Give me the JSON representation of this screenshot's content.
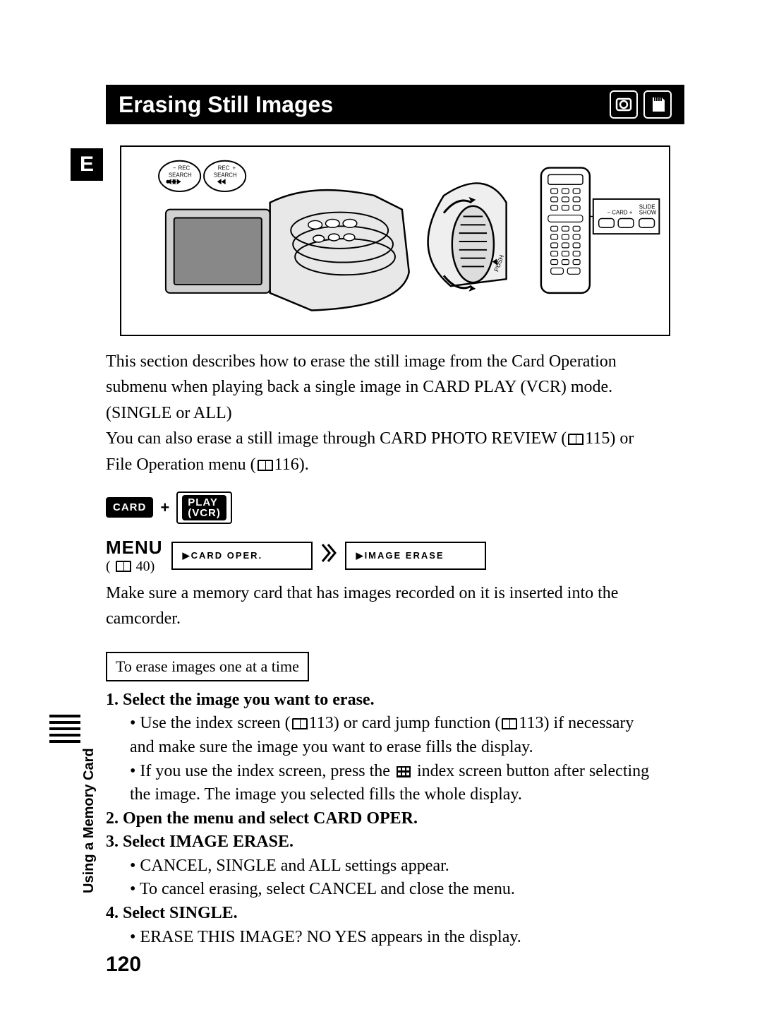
{
  "title": "Erasing Still Images",
  "lang_badge": "E",
  "intro": {
    "l1": "This section describes how to erase the still image from the Card Operation",
    "l2": "submenu when playing back a single image in CARD PLAY (VCR) mode.",
    "l3": "(SINGLE or ALL)",
    "l4a": "You can also erase a still image through CARD PHOTO REVIEW (",
    "l4b": "115) or",
    "l5a": "File Operation menu (",
    "l5b": "116)."
  },
  "mode": {
    "card": "CARD",
    "play": "PLAY",
    "vcr": "(VCR)"
  },
  "menu": {
    "label": "MENU",
    "ref": "40)",
    "box1": "CARD OPER.",
    "box2": "IMAGE ERASE"
  },
  "note": {
    "l1": "Make sure a memory card that has images recorded on it is inserted into the",
    "l2": "camcorder."
  },
  "inset": "To erase images one at a time",
  "steps": {
    "s1": "1. Select the image you want to erase.",
    "s1b1a": "Use the index screen (",
    "s1b1b": "113) or card jump function (",
    "s1b1c": "113) if necessary",
    "s1b1d": "and make sure the image you want to erase fills the display.",
    "s1b2a": "If you use the index screen, press the ",
    "s1b2b": " index screen button after selecting",
    "s1b2c": "the image. The image you selected fills the whole display.",
    "s2": "2. Open the menu and select CARD OPER.",
    "s3": "3. Select IMAGE ERASE.",
    "s3b1": "CANCEL, SINGLE and ALL settings appear.",
    "s3b2": "To cancel erasing, select CANCEL and close the menu.",
    "s4": "4. Select SINGLE.",
    "s4b1": "ERASE THIS IMAGE? NO YES appears in the display."
  },
  "section_tab": "Using a Memory Card",
  "page_number": "120",
  "illus": {
    "rec_minus": "REC",
    "search_l": "SEARCH",
    "rec_plus": "REC",
    "search_r": "SEARCH",
    "push": "PUSH",
    "slide": "SLIDE",
    "show": "SHOW",
    "card_label": "CARD"
  }
}
